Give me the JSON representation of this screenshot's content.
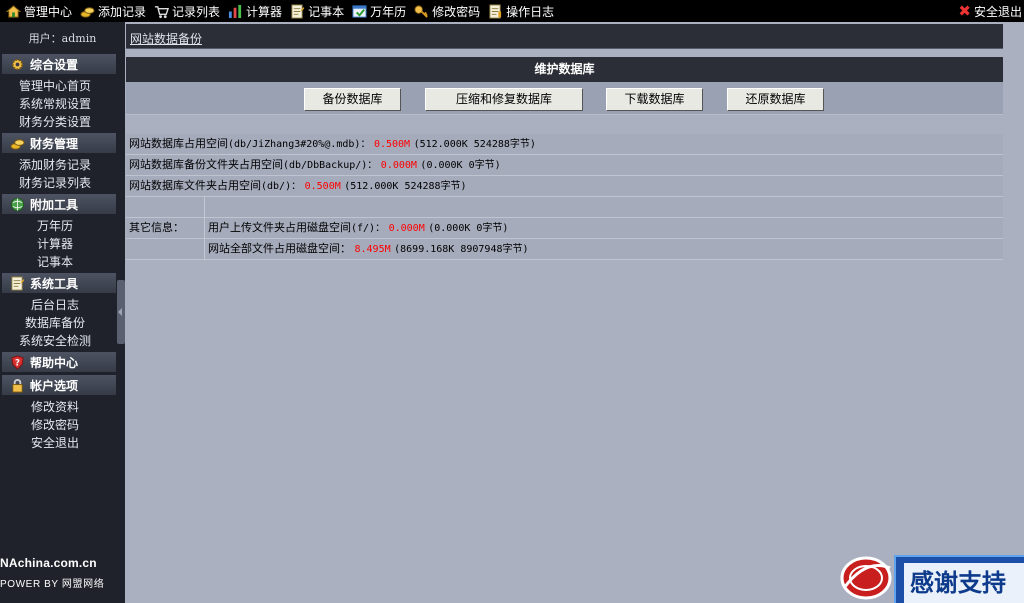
{
  "topbar": {
    "items": [
      {
        "label": "管理中心",
        "icon": "home-icon"
      },
      {
        "label": "添加记录",
        "icon": "coins-icon"
      },
      {
        "label": "记录列表",
        "icon": "cart-icon"
      },
      {
        "label": "计算器",
        "icon": "chart-icon"
      },
      {
        "label": "记事本",
        "icon": "notepad-icon"
      },
      {
        "label": "万年历",
        "icon": "calendar-icon"
      },
      {
        "label": "修改密码",
        "icon": "key-icon"
      },
      {
        "label": "操作日志",
        "icon": "log-icon"
      }
    ],
    "logout_label": "安全退出"
  },
  "sidebar": {
    "user_label": "用户：",
    "user_name": "admin",
    "groups": [
      {
        "title": "综合设置",
        "icon": "gear-icon",
        "items": [
          "管理中心首页",
          "系统常规设置",
          "财务分类设置"
        ]
      },
      {
        "title": "财务管理",
        "icon": "coins-icon",
        "items": [
          "添加财务记录",
          "财务记录列表"
        ]
      },
      {
        "title": "附加工具",
        "icon": "globe-icon",
        "items": [
          "万年历",
          "计算器",
          "记事本"
        ]
      },
      {
        "title": "系统工具",
        "icon": "notepad-icon",
        "items": [
          "后台日志",
          "数据库备份",
          "系统安全检测"
        ]
      },
      {
        "title": "帮助中心",
        "icon": "help-icon",
        "items": []
      },
      {
        "title": "帐户选项",
        "icon": "lock-icon",
        "items": [
          "修改资料",
          "修改密码",
          "安全退出"
        ]
      }
    ],
    "brand_line1": "NAchina.com.cn",
    "brand_line2": "POWER BY  网盟网络"
  },
  "main": {
    "breadcrumb": "网站数据备份",
    "header": "维护数据库",
    "buttons": [
      "备份数据库",
      "压缩和修复数据库",
      "下载数据库",
      "还原数据库"
    ],
    "rows": [
      {
        "label": "网站数据库占用空间",
        "path": "(db/JiZhang3#20%@.mdb)：",
        "value": "0.500M",
        "detail": "(512.000K 524288字节)"
      },
      {
        "label": "网站数据库备份文件夹占用空间",
        "path": "(db/DbBackup/)：",
        "value": "0.000M",
        "detail": "(0.000K 0字节)"
      },
      {
        "label": "网站数据库文件夹占用空间",
        "path": "(db/)：",
        "value": "0.500M",
        "detail": "(512.000K 524288字节)"
      }
    ],
    "other_label": "其它信息：",
    "other_rows": [
      {
        "label": "用户上传文件夹占用磁盘空间",
        "path": "(f/)：",
        "value": "0.000M",
        "detail": "(0.000K 0字节)"
      },
      {
        "label": "网站全部文件占用磁盘空间：",
        "path": "",
        "value": "8.495M",
        "detail": "(8699.168K 8907948字节)"
      }
    ]
  },
  "support": {
    "label": "感谢支持"
  },
  "colors": {
    "accent_red": "#ff0000",
    "header_bg": "#2b2e36",
    "sidebar_bg": "#1f222a",
    "content_bg": "#aab0c0"
  }
}
